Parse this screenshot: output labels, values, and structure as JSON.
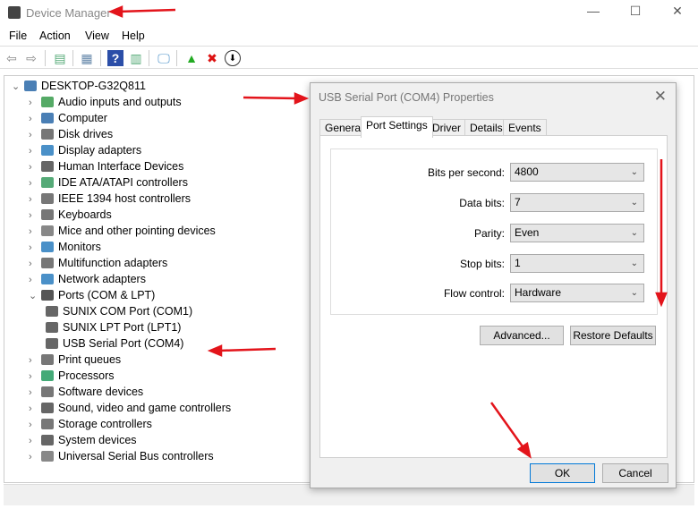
{
  "window": {
    "title": "Device Manager",
    "minimize": "—",
    "maximize": "☐",
    "close": "✕"
  },
  "menu": [
    "File",
    "Action",
    "View",
    "Help"
  ],
  "toolbar": {
    "back": "⇦",
    "forward": "⇨",
    "show_hide": "▤",
    "properties": "▦",
    "help": "?",
    "action": "▥",
    "scan": "🖵",
    "update": "▲",
    "uninstall": "✖",
    "disable": "⬇"
  },
  "tree": {
    "root": "DESKTOP-G32Q811",
    "items": [
      {
        "label": "Audio inputs and outputs",
        "expanded": false
      },
      {
        "label": "Computer",
        "expanded": false
      },
      {
        "label": "Disk drives",
        "expanded": false
      },
      {
        "label": "Display adapters",
        "expanded": false
      },
      {
        "label": "Human Interface Devices",
        "expanded": false
      },
      {
        "label": "IDE ATA/ATAPI controllers",
        "expanded": false
      },
      {
        "label": "IEEE 1394 host controllers",
        "expanded": false
      },
      {
        "label": "Keyboards",
        "expanded": false
      },
      {
        "label": "Mice and other pointing devices",
        "expanded": false
      },
      {
        "label": "Monitors",
        "expanded": false
      },
      {
        "label": "Multifunction adapters",
        "expanded": false
      },
      {
        "label": "Network adapters",
        "expanded": false
      },
      {
        "label": "Ports (COM & LPT)",
        "expanded": true
      },
      {
        "label": "SUNIX COM Port (COM1)",
        "child": true
      },
      {
        "label": "SUNIX LPT Port (LPT1)",
        "child": true
      },
      {
        "label": "USB Serial Port (COM4)",
        "child": true
      },
      {
        "label": "Print queues",
        "expanded": false
      },
      {
        "label": "Processors",
        "expanded": false
      },
      {
        "label": "Software devices",
        "expanded": false
      },
      {
        "label": "Sound, video and game controllers",
        "expanded": false
      },
      {
        "label": "Storage controllers",
        "expanded": false
      },
      {
        "label": "System devices",
        "expanded": false
      },
      {
        "label": "Universal Serial Bus controllers",
        "expanded": false
      }
    ]
  },
  "dialog": {
    "title": "USB Serial Port (COM4) Properties",
    "close": "✕",
    "tabs": [
      "General",
      "Port Settings",
      "Driver",
      "Details",
      "Events"
    ],
    "active_tab": "Port Settings",
    "fields": [
      {
        "label": "Bits per second:",
        "value": "4800"
      },
      {
        "label": "Data bits:",
        "value": "7"
      },
      {
        "label": "Parity:",
        "value": "Even"
      },
      {
        "label": "Stop bits:",
        "value": "1"
      },
      {
        "label": "Flow control:",
        "value": "Hardware"
      }
    ],
    "advanced": "Advanced...",
    "restore": "Restore Defaults",
    "ok": "OK",
    "cancel": "Cancel"
  },
  "colors": {
    "annotation": "#e3141b",
    "accent": "#0078d7"
  }
}
